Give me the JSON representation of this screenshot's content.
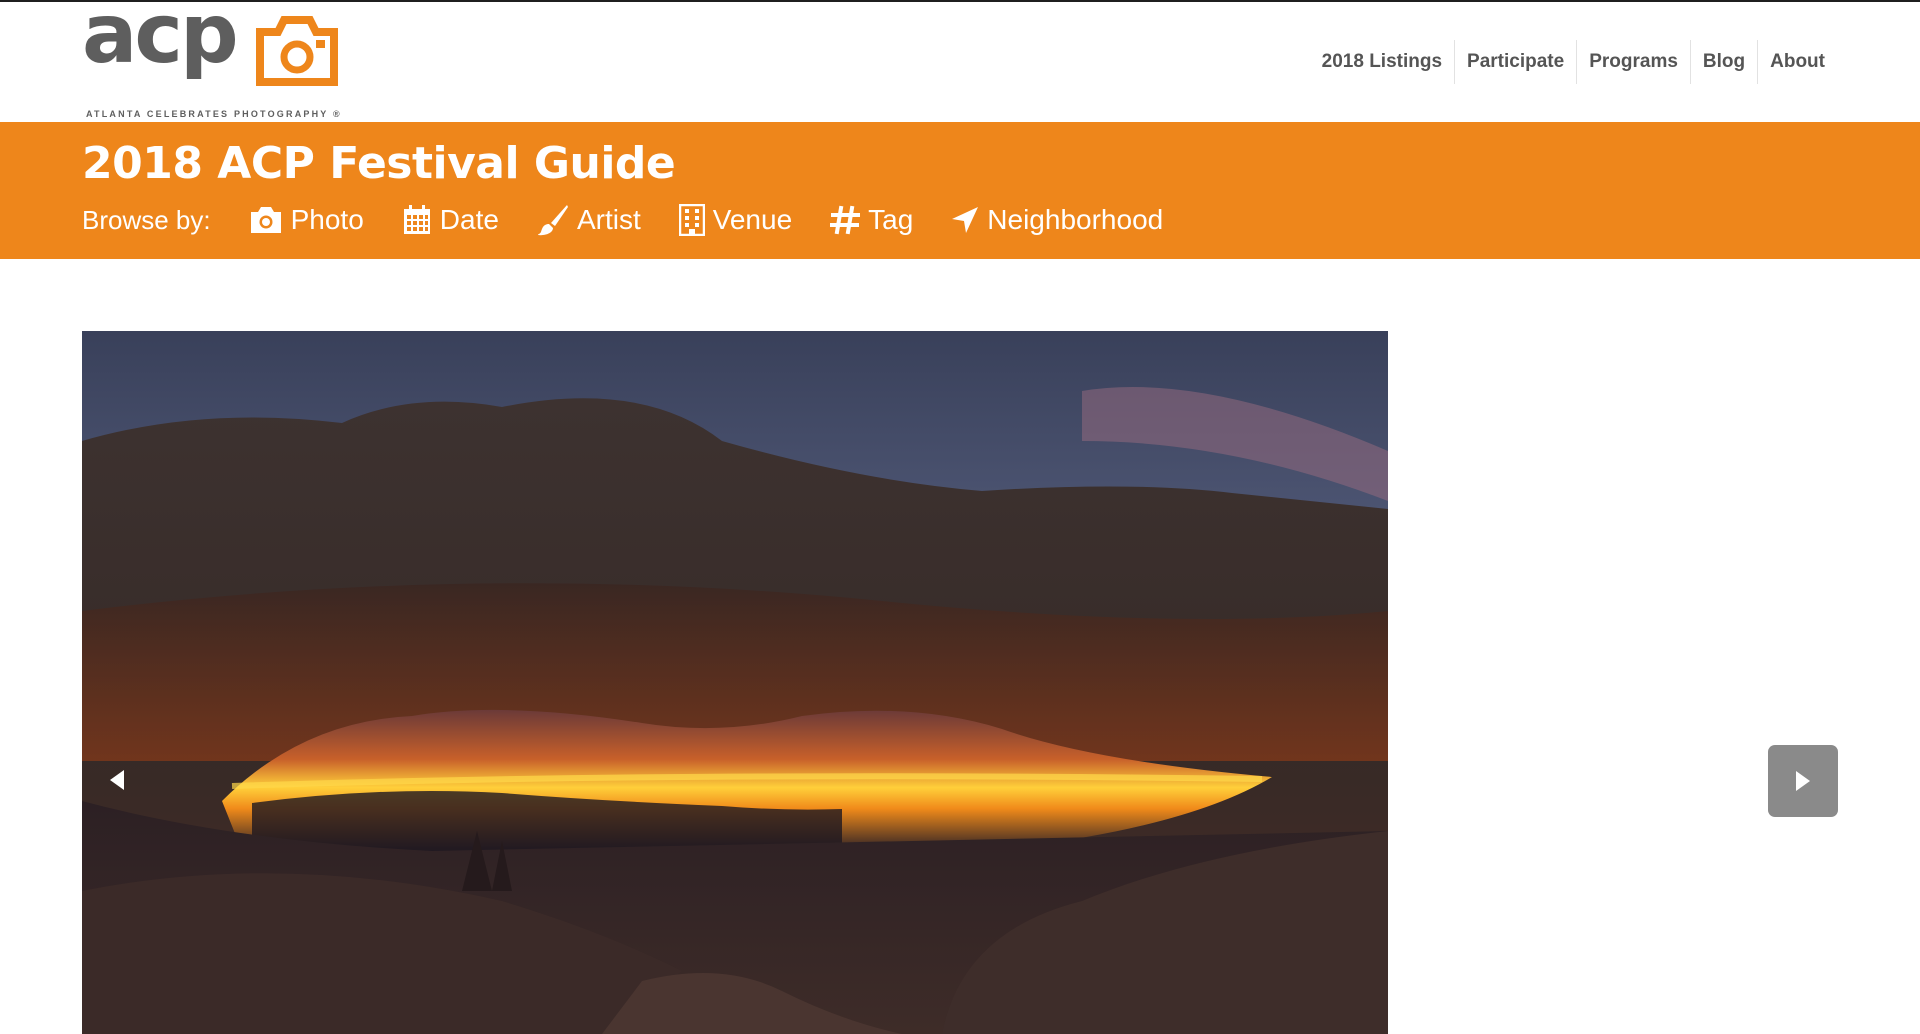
{
  "logo": {
    "wordmark": "acp",
    "tagline": "ATLANTA CELEBRATES PHOTOGRAPHY ®"
  },
  "nav": {
    "items": [
      {
        "label": "2018 Listings"
      },
      {
        "label": "Participate"
      },
      {
        "label": "Programs"
      },
      {
        "label": "Blog"
      },
      {
        "label": "About"
      }
    ]
  },
  "guide": {
    "title": "2018 ACP Festival Guide",
    "browse_label": "Browse by:",
    "browse_items": [
      {
        "label": "Photo",
        "icon": "camera-icon"
      },
      {
        "label": "Date",
        "icon": "calendar-icon"
      },
      {
        "label": "Artist",
        "icon": "paintbrush-icon"
      },
      {
        "label": "Venue",
        "icon": "building-icon"
      },
      {
        "label": "Tag",
        "icon": "hashtag-icon"
      },
      {
        "label": "Neighborhood",
        "icon": "location-arrow-icon"
      }
    ]
  },
  "slider": {
    "prev_icon": "caret-left-icon",
    "next_icon": "caret-right-icon"
  },
  "colors": {
    "brand_orange": "#ee861b",
    "logo_gray": "#5e5e5e",
    "nav_text": "#555555",
    "arrow_button": "#8a8a8a"
  }
}
